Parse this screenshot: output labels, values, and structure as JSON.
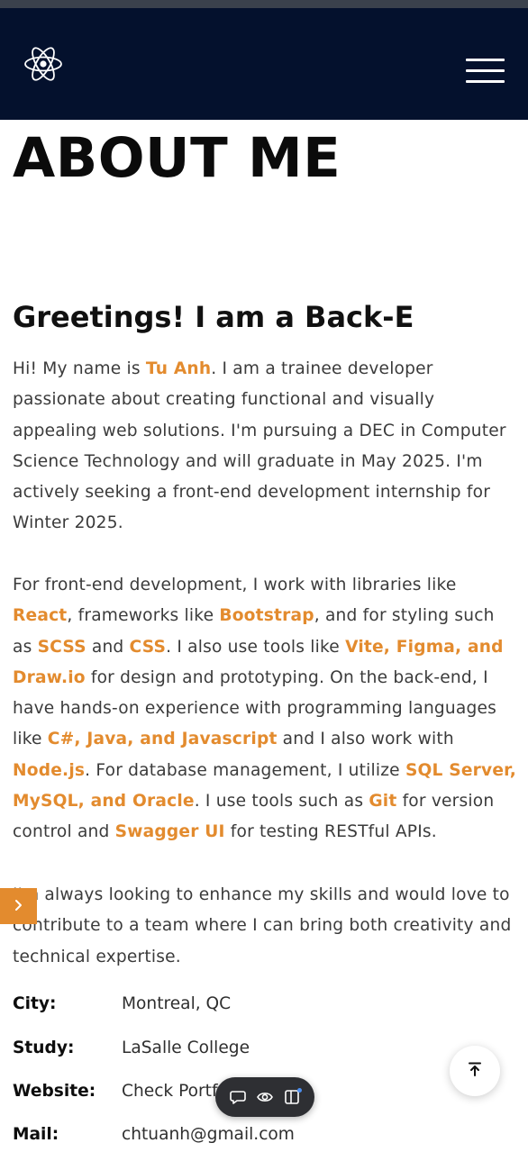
{
  "header": {
    "logo_icon": "react-atom-icon",
    "menu_icon": "hamburger-menu-icon",
    "background": "#04112d"
  },
  "about": {
    "title": "ABOUT ME",
    "greeting": "Greetings! I am a Back-E",
    "accent_color": "#e38b2e",
    "p1": {
      "t1": "Hi! My name is ",
      "name": "Tu Anh",
      "t2": ". I am a trainee developer passionate about creating functional and visually appealing web solutions. I'm pursuing a DEC in Computer Science Technology and will graduate in May 2025. I'm actively seeking a front-end development internship for Winter 2025."
    },
    "p2": {
      "t1": "For front-end development, I work with libraries like ",
      "h1": "React",
      "t2": ", frameworks like ",
      "h2": "Bootstrap",
      "t3": ", and for styling such as ",
      "h3": "SCSS",
      "t4": " and ",
      "h4": "CSS",
      "t5": ". I also use tools like ",
      "h5": "Vite, Figma, and Draw.io",
      "t6": " for design and prototyping. On the back-end, I have hands-on experience with programming languages like ",
      "h6": "C#, Java, and Javascript",
      "t7": " and I also work with ",
      "h7": "Node.js",
      "t8": ". For database management, I utilize ",
      "h8": "SQL Server, MySQL, and Oracle",
      "t9": ". I use tools such as ",
      "h9": "Git",
      "t10": " for version control and ",
      "h10": "Swagger UI",
      "t11": " for testing RESTful APIs."
    },
    "p3": "I'm always looking to enhance my skills and would love to contribute to a team where I can bring both creativity and technical expertise.",
    "info": [
      {
        "label": "City:",
        "value": "Montreal, QC"
      },
      {
        "label": "Study:",
        "value": "LaSalle College"
      },
      {
        "label": "Website:",
        "value": "Check Portfolio"
      },
      {
        "label": "Mail:",
        "value": "chtuanh@gmail.com"
      }
    ]
  },
  "floating": {
    "side_tab_icon": "chevron-right-icon",
    "scroll_top_icon": "arrow-up-to-top-icon",
    "toolbar_icons": [
      "chat-bubble-icon",
      "eye-icon",
      "sidebar-panel-icon"
    ]
  }
}
